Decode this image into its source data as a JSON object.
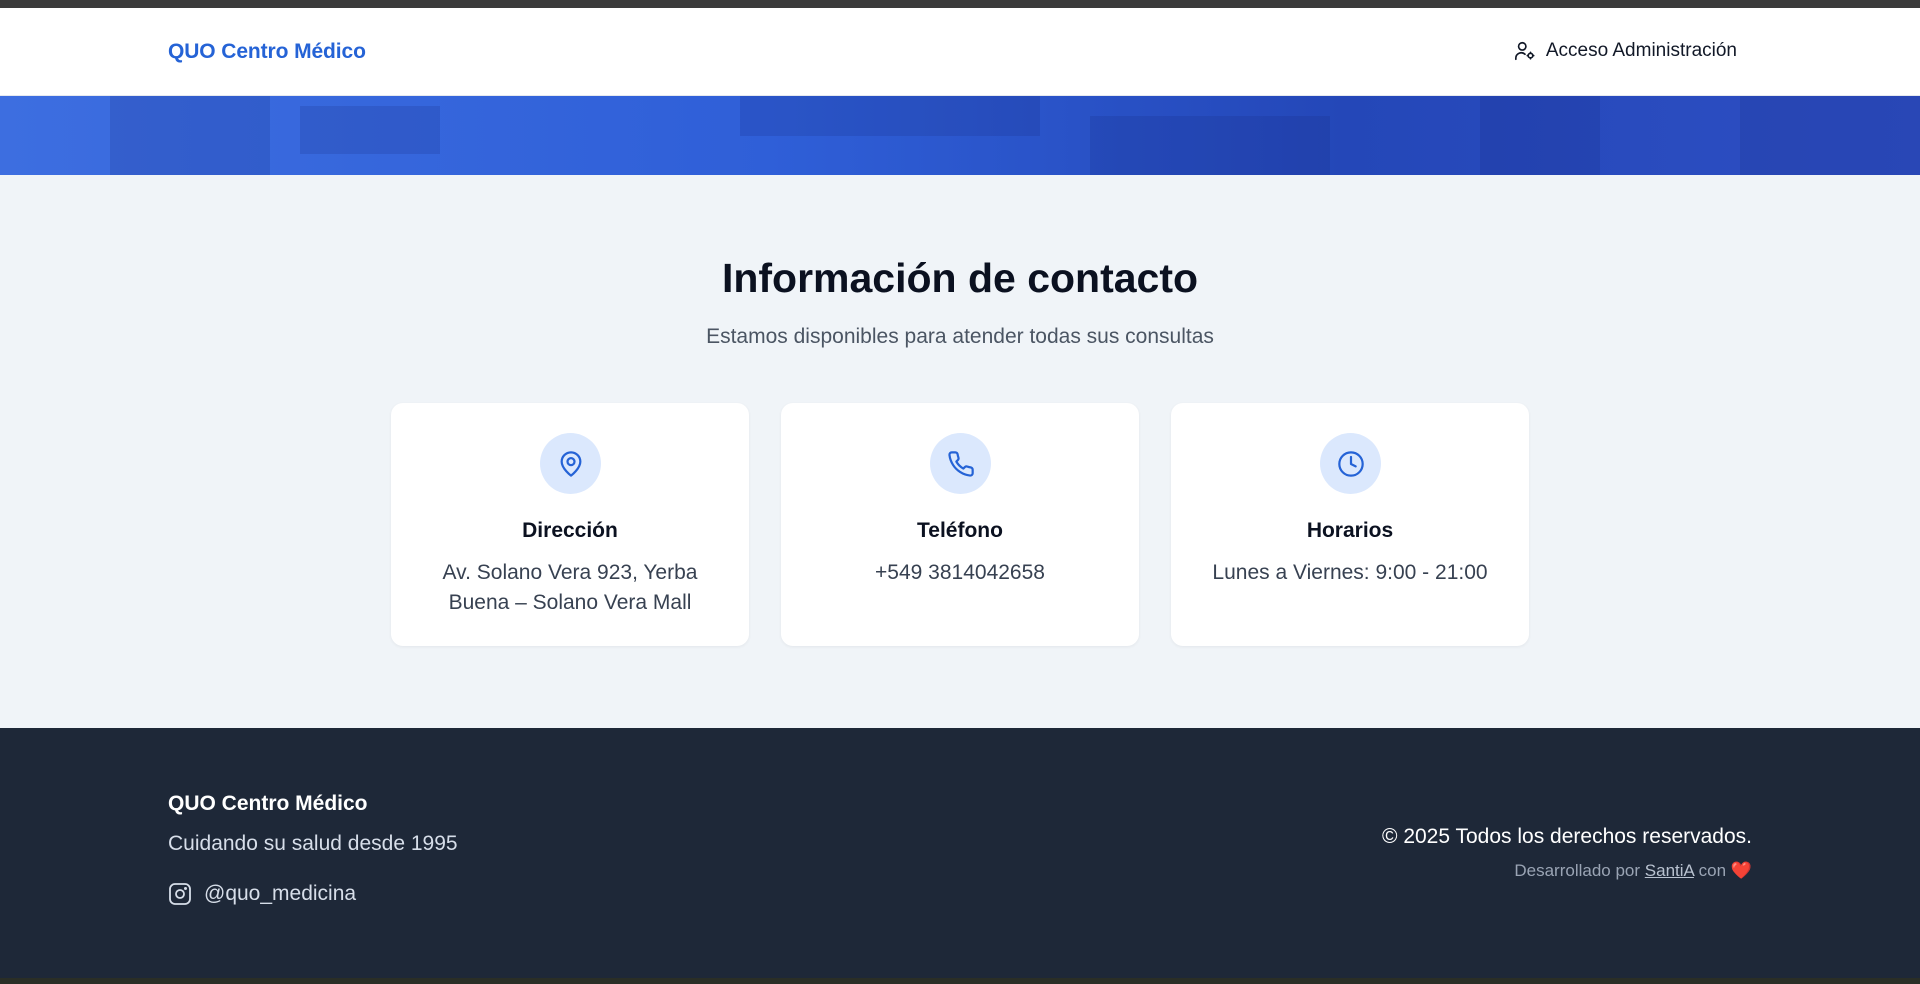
{
  "header": {
    "brand": "QUO Centro Médico",
    "admin_link": "Acceso Administración"
  },
  "contact": {
    "title": "Información de contacto",
    "subtitle": "Estamos disponibles para atender todas sus consultas",
    "cards": [
      {
        "icon": "map-pin-icon",
        "title": "Dirección",
        "value": "Av. Solano Vera 923, Yerba Buena – Solano Vera Mall"
      },
      {
        "icon": "phone-icon",
        "title": "Teléfono",
        "value": "+549 3814042658"
      },
      {
        "icon": "clock-icon",
        "title": "Horarios",
        "value": "Lunes a Viernes: 9:00 - 21:00"
      }
    ]
  },
  "footer": {
    "brand": "QUO Centro Médico",
    "tagline": "Cuidando su salud desde 1995",
    "instagram_handle": "@quo_medicina",
    "copyright": "© 2025 Todos los derechos reservados.",
    "developed_prefix": "Desarrollado por",
    "developer": "SantiA",
    "developed_suffix": "con",
    "heart": "❤️"
  },
  "colors": {
    "brand": "#2563d6",
    "hero": "#2f5fd8",
    "section_bg": "#f0f4f8",
    "icon_bg": "#dbe8fd",
    "footer_bg": "#1e2838"
  }
}
